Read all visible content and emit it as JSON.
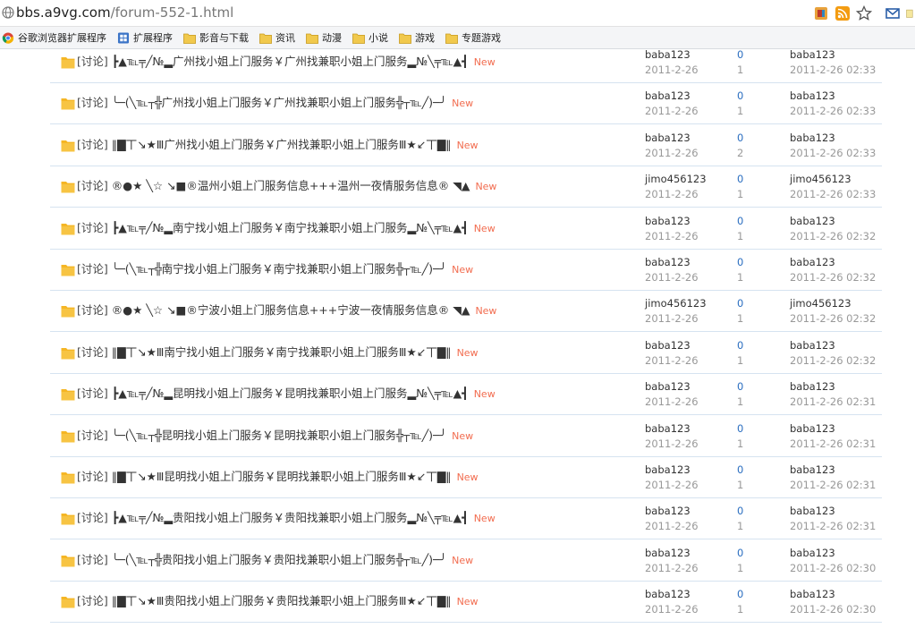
{
  "address_bar": {
    "url_host": "bbs.a9vg.com",
    "url_path": "/forum-552-1.html"
  },
  "bookmarks": [
    {
      "label": "谷歌浏览器扩展程序",
      "icon": "chrome-icon"
    },
    {
      "label": "扩展程序",
      "icon": "puzzle-icon"
    },
    {
      "label": "影音与下载",
      "icon": "folder-icon"
    },
    {
      "label": "资讯",
      "icon": "folder-icon"
    },
    {
      "label": "动漫",
      "icon": "folder-icon"
    },
    {
      "label": "小说",
      "icon": "folder-icon"
    },
    {
      "label": "游戏",
      "icon": "folder-icon"
    },
    {
      "label": "专题游戏",
      "icon": "folder-icon"
    }
  ],
  "threads": [
    {
      "tag": "[讨论]",
      "title": " ┣▲℡╤╱№▂广州找小姐上门服务￥广州找兼职小姐上门服务▂№╲╤℡▲┫",
      "new": "New",
      "author": "baba123",
      "date": "2011-2-26",
      "replies": "0",
      "views": "1",
      "last_user": "baba123",
      "last_time": "2011-2-26 02:33"
    },
    {
      "tag": "[讨论]",
      "title": " ╰─(╲℡┬╬广州找小姐上门服务￥广州找兼职小姐上门服务╬┬℡╱)─╯",
      "new": "New",
      "author": "baba123",
      "date": "2011-2-26",
      "replies": "0",
      "views": "1",
      "last_user": "baba123",
      "last_time": "2011-2-26 02:33"
    },
    {
      "tag": "[讨论]",
      "title": " ‖▇丅↘★Ⅲ广州找小姐上门服务￥广州找兼职小姐上门服务Ⅲ★↙丅▇‖",
      "new": "New",
      "author": "baba123",
      "date": "2011-2-26",
      "replies": "0",
      "views": "2",
      "last_user": "baba123",
      "last_time": "2011-2-26 02:33"
    },
    {
      "tag": "[讨论]",
      "title": " ®●★ ╲☆ ↘■®温州小姐上门服务信息+++温州一夜情服务信息® ◥▲",
      "new": "New",
      "author": "jimo456123",
      "date": "2011-2-26",
      "replies": "0",
      "views": "1",
      "last_user": "jimo456123",
      "last_time": "2011-2-26 02:33"
    },
    {
      "tag": "[讨论]",
      "title": " ┣▲℡╤╱№▂南宁找小姐上门服务￥南宁找兼职小姐上门服务▂№╲╤℡▲┫",
      "new": "New",
      "author": "baba123",
      "date": "2011-2-26",
      "replies": "0",
      "views": "1",
      "last_user": "baba123",
      "last_time": "2011-2-26 02:32"
    },
    {
      "tag": "[讨论]",
      "title": " ╰─(╲℡┬╬南宁找小姐上门服务￥南宁找兼职小姐上门服务╬┬℡╱)─╯",
      "new": "New",
      "author": "baba123",
      "date": "2011-2-26",
      "replies": "0",
      "views": "1",
      "last_user": "baba123",
      "last_time": "2011-2-26 02:32"
    },
    {
      "tag": "[讨论]",
      "title": " ®●★ ╲☆ ↘■®宁波小姐上门服务信息+++宁波一夜情服务信息® ◥▲",
      "new": "New",
      "author": "jimo456123",
      "date": "2011-2-26",
      "replies": "0",
      "views": "1",
      "last_user": "jimo456123",
      "last_time": "2011-2-26 02:32"
    },
    {
      "tag": "[讨论]",
      "title": " ‖▇丅↘★Ⅲ南宁找小姐上门服务￥南宁找兼职小姐上门服务Ⅲ★↙丅▇‖",
      "new": "New",
      "author": "baba123",
      "date": "2011-2-26",
      "replies": "0",
      "views": "1",
      "last_user": "baba123",
      "last_time": "2011-2-26 02:32"
    },
    {
      "tag": "[讨论]",
      "title": " ┣▲℡╤╱№▂昆明找小姐上门服务￥昆明找兼职小姐上门服务▂№╲╤℡▲┫",
      "new": "New",
      "author": "baba123",
      "date": "2011-2-26",
      "replies": "0",
      "views": "1",
      "last_user": "baba123",
      "last_time": "2011-2-26 02:31"
    },
    {
      "tag": "[讨论]",
      "title": " ╰─(╲℡┬╬昆明找小姐上门服务￥昆明找兼职小姐上门服务╬┬℡╱)─╯",
      "new": "New",
      "author": "baba123",
      "date": "2011-2-26",
      "replies": "0",
      "views": "1",
      "last_user": "baba123",
      "last_time": "2011-2-26 02:31"
    },
    {
      "tag": "[讨论]",
      "title": " ‖▇丅↘★Ⅲ昆明找小姐上门服务￥昆明找兼职小姐上门服务Ⅲ★↙丅▇‖",
      "new": "New",
      "author": "baba123",
      "date": "2011-2-26",
      "replies": "0",
      "views": "1",
      "last_user": "baba123",
      "last_time": "2011-2-26 02:31"
    },
    {
      "tag": "[讨论]",
      "title": " ┣▲℡╤╱№▂贵阳找小姐上门服务￥贵阳找兼职小姐上门服务▂№╲╤℡▲┫",
      "new": "New",
      "author": "baba123",
      "date": "2011-2-26",
      "replies": "0",
      "views": "1",
      "last_user": "baba123",
      "last_time": "2011-2-26 02:31"
    },
    {
      "tag": "[讨论]",
      "title": " ╰─(╲℡┬╬贵阳找小姐上门服务￥贵阳找兼职小姐上门服务╬┬℡╱)─╯",
      "new": "New",
      "author": "baba123",
      "date": "2011-2-26",
      "replies": "0",
      "views": "1",
      "last_user": "baba123",
      "last_time": "2011-2-26 02:30"
    },
    {
      "tag": "[讨论]",
      "title": " ‖▇丅↘★Ⅲ贵阳找小姐上门服务￥贵阳找兼职小姐上门服务Ⅲ★↙丅▇‖",
      "new": "New",
      "author": "baba123",
      "date": "2011-2-26",
      "replies": "0",
      "views": "1",
      "last_user": "baba123",
      "last_time": "2011-2-26 02:30"
    }
  ]
}
